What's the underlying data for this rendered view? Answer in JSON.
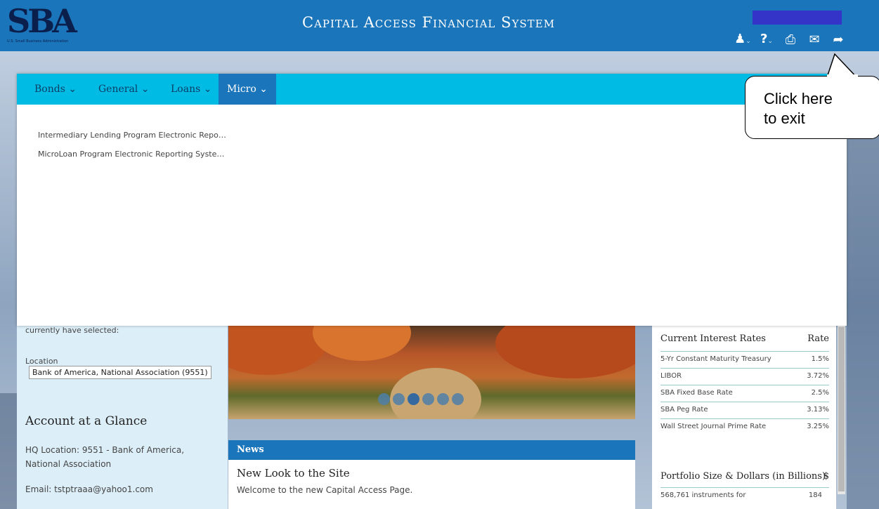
{
  "header": {
    "logo_text": "SBA",
    "logo_subtext": "U.S. Small Business Administration",
    "title": "Capital Access Financial System",
    "user_box_color": "#3434c8"
  },
  "toolbar": [
    {
      "icon": "user-icon",
      "glyph": "👤",
      "has_caret": true
    },
    {
      "icon": "help-icon",
      "glyph": "?",
      "has_caret": true
    },
    {
      "icon": "print-icon",
      "glyph": "⎙",
      "has_caret": false
    },
    {
      "icon": "mail-icon",
      "glyph": "✉",
      "has_caret": false
    },
    {
      "icon": "exit-icon",
      "glyph": "➦",
      "has_caret": false
    }
  ],
  "nav": {
    "items": [
      {
        "label": "Bonds ⌄",
        "active": false
      },
      {
        "label": "General ⌄",
        "active": false
      },
      {
        "label": "Loans ⌄",
        "active": false
      },
      {
        "label": "Micro ⌄",
        "active": true
      }
    ],
    "submenu": [
      "Intermediary Lending Program Electronic Repo…",
      "MicroLoan Program Electronic Reporting Syste…"
    ]
  },
  "callout": {
    "line1": "Click here",
    "line2": "to exit"
  },
  "left": {
    "cutoff_text": "currently have selected:",
    "location_label": "Location",
    "location_value": "Bank of America, National Association (9551)",
    "glance_title": "Account at a Glance",
    "hq_text": "HQ Location: 9551 - Bank of America, National Association",
    "email_text": "Email: tstptraaa@yahoo1.com"
  },
  "carousel": {
    "slide_count": 6,
    "active_index": 2
  },
  "news": {
    "header": "News",
    "title": "New Look to the Site",
    "body": "Welcome to the new Capital Access Page."
  },
  "rates": {
    "header": "Current Interest Rates",
    "header_right": "Rate",
    "rows": [
      {
        "name": "5-Yr Constant Maturity Treasury",
        "value": "1.5%"
      },
      {
        "name": "LIBOR",
        "value": "3.72%"
      },
      {
        "name": "SBA Fixed Base Rate",
        "value": "2.5%"
      },
      {
        "name": "SBA Peg Rate",
        "value": "3.13%"
      },
      {
        "name": "Wall Street Journal Prime Rate",
        "value": "3.25%"
      }
    ]
  },
  "portfolio": {
    "header": "Portfolio Size & Dollars (in Billions)",
    "header_right": "$",
    "row_label": "568,761 instruments for",
    "row_value": "184"
  }
}
